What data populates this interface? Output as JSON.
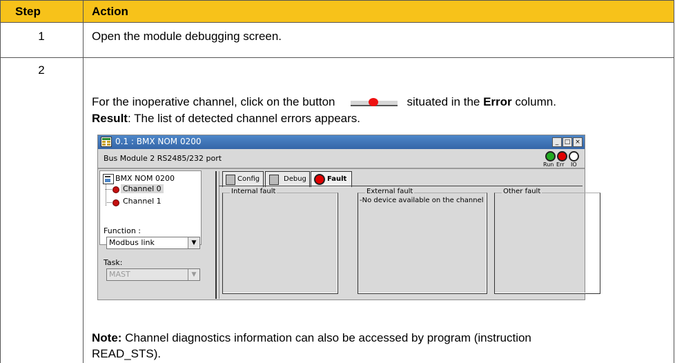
{
  "table": {
    "headers": {
      "step": "Step",
      "action": "Action"
    },
    "rows": [
      {
        "step": "1",
        "action": "Open the module debugging screen."
      },
      {
        "step": "2",
        "line1_pre": "For the inoperative channel, click on the button",
        "line1_post": "situated in the",
        "line1_bold": "Error",
        "line1_end": "column.",
        "result_label": "Result",
        "result_text": ": The list of detected channel errors appears.",
        "note_label": "Note:",
        "note_text1": " Channel diagnostics information can also be accessed by program (instruction",
        "note_text2": "READ_STS)."
      }
    ]
  },
  "window": {
    "title": "0.1 : BMX NOM 0200",
    "title_buttons": [
      "_",
      "□",
      "×"
    ],
    "info": "Bus Module   2 RS2485/232 port",
    "leds": [
      {
        "label": "Run",
        "color": "#22aa22"
      },
      {
        "label": "Err",
        "color": "#e10000"
      },
      {
        "label": "IO",
        "color": "#ffffff"
      }
    ],
    "tree": {
      "root": "BMX NOM 0200",
      "channels": [
        "Channel 0",
        "Channel 1"
      ]
    },
    "function_label": "Function :",
    "function_value": "Modbus link",
    "task_label": "Task:",
    "task_value": "MAST",
    "tabs": [
      "Config",
      "Debug",
      "Fault"
    ],
    "groups": [
      {
        "title": "Internal fault",
        "content": ""
      },
      {
        "title": "External fault",
        "content": "-No device available on the channel"
      },
      {
        "title": "Other fault",
        "content": ""
      }
    ]
  },
  "icons": {
    "inline_button": "error-button-icon",
    "window_icon": "module-icon",
    "fault_tab": "fault-red-dot-icon"
  }
}
